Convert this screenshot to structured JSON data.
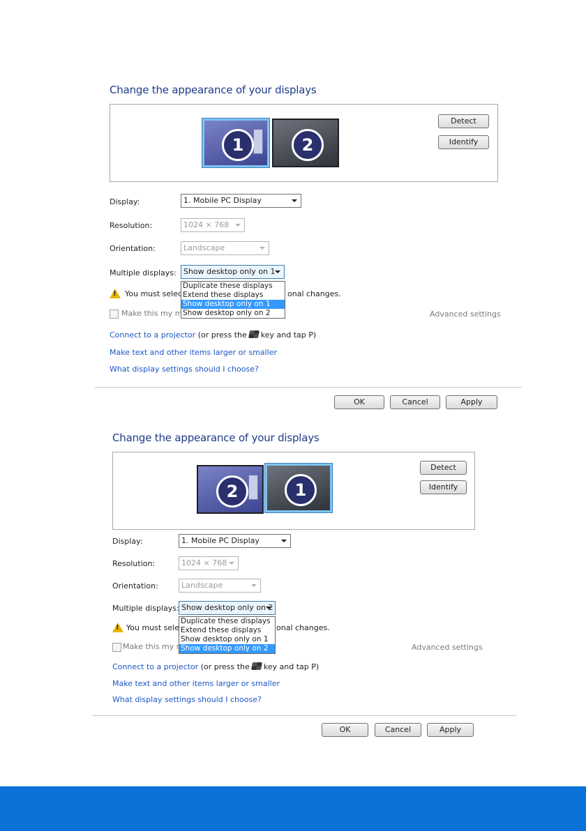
{
  "panels": [
    {
      "heading": "Change the appearance of your displays",
      "monitors": [
        "1",
        "2"
      ],
      "detect_label": "Detect",
      "identify_label": "Identify",
      "display_label": "Display:",
      "display_value": "1. Mobile PC Display",
      "resolution_label": "Resolution:",
      "resolution_value": "1024 × 768",
      "orientation_label": "Orientation:",
      "orientation_value": "Landscape",
      "multiple_label": "Multiple displays:",
      "multiple_value": "Show desktop only on 1",
      "options": [
        "Duplicate these displays",
        "Extend these displays",
        "Show desktop only on 1",
        "Show desktop only on 2"
      ],
      "selected_option": 2,
      "warning_start": "You must selec",
      "warning_end": "onal changes.",
      "main_checkbox_label": "Make this my m",
      "advanced_link": "Advanced settings",
      "projector_link": "Connect to a projector",
      "projector_hint_start": "(or press the",
      "projector_hint_end": "key and tap P)",
      "text_size_link": "Make text and other items larger or smaller",
      "help_link": "What display settings should I choose?",
      "ok_label": "OK",
      "cancel_label": "Cancel",
      "apply_label": "Apply"
    },
    {
      "heading": "Change the appearance of your displays",
      "monitors": [
        "2",
        "1"
      ],
      "detect_label": "Detect",
      "identify_label": "Identify",
      "display_label": "Display:",
      "display_value": "1. Mobile PC Display",
      "resolution_label": "Resolution:",
      "resolution_value": "1024 × 768",
      "orientation_label": "Orientation:",
      "orientation_value": "Landscape",
      "multiple_label": "Multiple displays:",
      "multiple_value": "Show desktop only on 2",
      "options": [
        "Duplicate these displays",
        "Extend these displays",
        "Show desktop only on 1",
        "Show desktop only on 2"
      ],
      "selected_option": 3,
      "warning_start": "You must selec",
      "warning_end": "onal changes.",
      "main_checkbox_label": "Make this my m",
      "advanced_link": "Advanced settings",
      "projector_link": "Connect to a projector",
      "projector_hint_start": "(or press the",
      "projector_hint_end": "key and tap P)",
      "text_size_link": "Make text and other items larger or smaller",
      "help_link": "What display settings should I choose?",
      "ok_label": "OK",
      "cancel_label": "Cancel",
      "apply_label": "Apply"
    }
  ],
  "colors": {
    "heading": "#1e3a8a",
    "link": "#1b56c4",
    "footer_bar": "#0a72d8",
    "dropdown_selected": "#3399ff"
  }
}
